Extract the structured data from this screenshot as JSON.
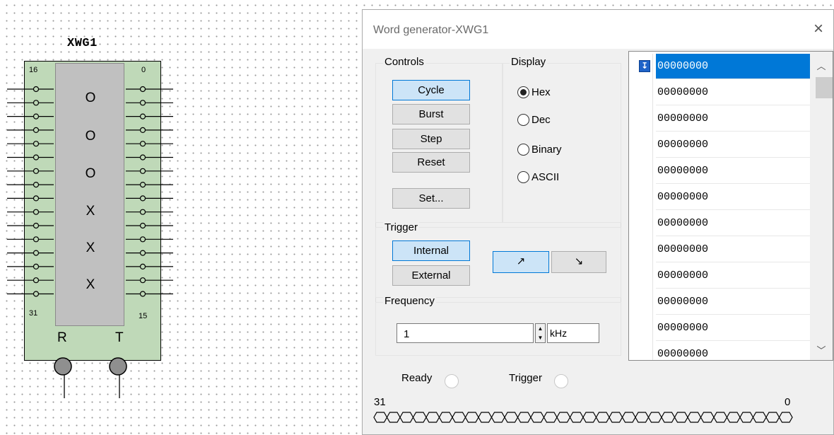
{
  "schematic": {
    "component_name": "XWG1",
    "pin_labels": {
      "top_left": "16",
      "top_right": "0",
      "bottom_left": "31",
      "bottom_right": "15"
    },
    "display_chars": [
      "O",
      "O",
      "O",
      "X",
      "X",
      "X"
    ],
    "reset_label": "R",
    "trigger_label": "T"
  },
  "dialog": {
    "title": "Word generator-XWG1",
    "close_glyph": "×",
    "controls": {
      "label": "Controls",
      "buttons": [
        "Cycle",
        "Burst",
        "Step",
        "Reset",
        "Set..."
      ],
      "active": "Cycle"
    },
    "display": {
      "label": "Display",
      "options": [
        "Hex",
        "Dec",
        "Binary",
        "ASCII"
      ],
      "selected": "Hex"
    },
    "trigger": {
      "label": "Trigger",
      "buttons": [
        "Internal",
        "External"
      ],
      "active": "Internal",
      "edge_rising_glyph": "↗",
      "edge_falling_glyph": "↘",
      "active_edge": "rising"
    },
    "frequency": {
      "label": "Frequency",
      "value": "1",
      "unit": "kHz"
    },
    "words": [
      "00000000",
      "00000000",
      "00000000",
      "00000000",
      "00000000",
      "00000000",
      "00000000",
      "00000000",
      "00000000",
      "00000000",
      "00000000",
      "00000000"
    ],
    "selected_word_index": 0,
    "cursor_glyph": "↧",
    "status": {
      "ready_label": "Ready",
      "trigger_label": "Trigger"
    },
    "bits": {
      "msb_label": "31",
      "lsb_label": "0",
      "count": 32
    }
  },
  "colors": {
    "component_body": "#bfd9b8",
    "selection": "#0078d7",
    "active_button": "#cce4f7"
  }
}
